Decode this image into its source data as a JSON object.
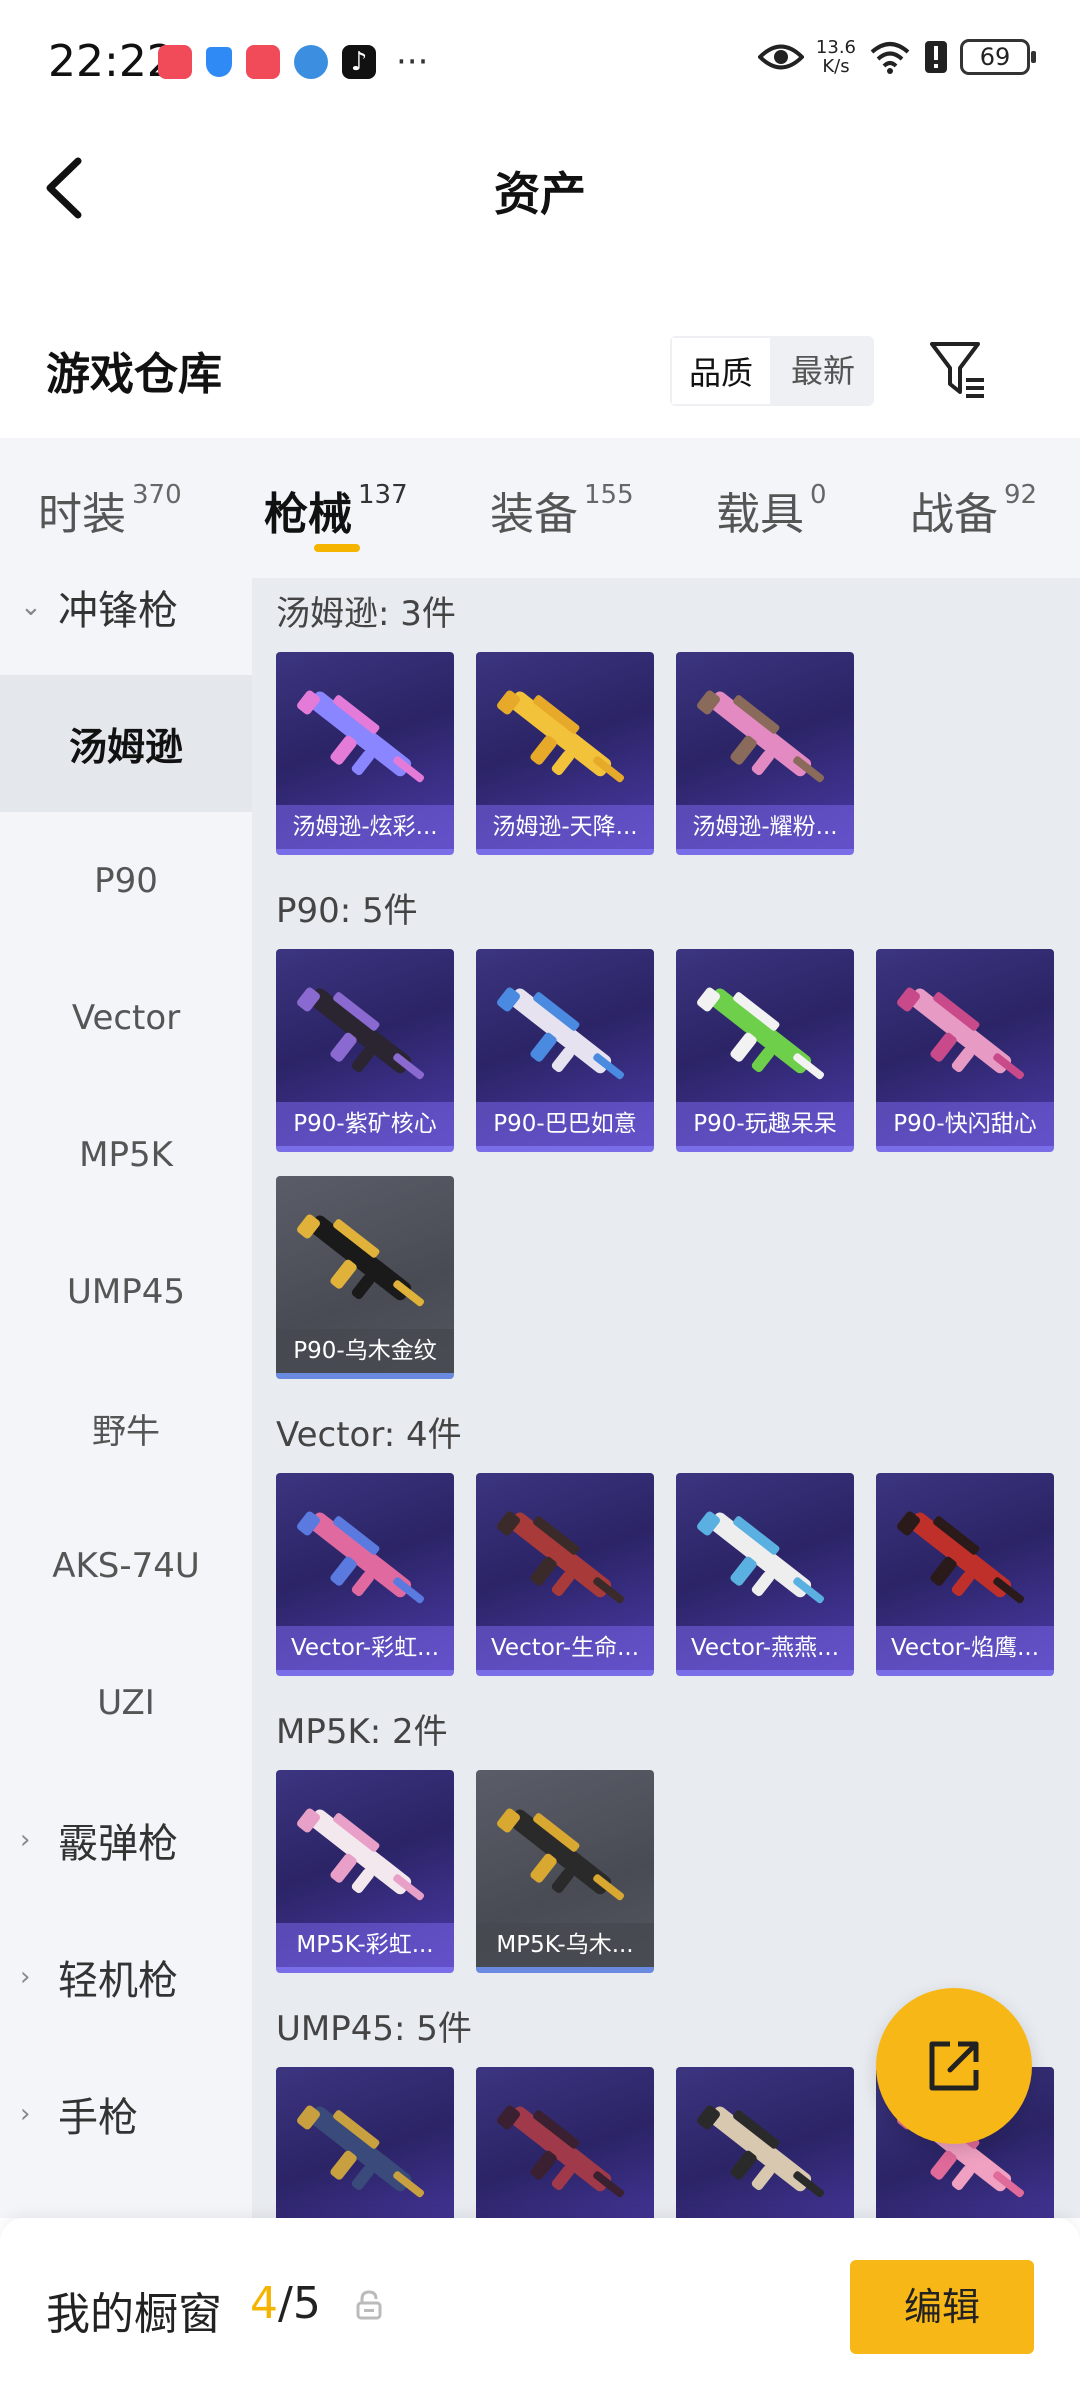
{
  "status": {
    "time": "22:22",
    "net_speed_value": "13.6",
    "net_speed_unit": "K/s",
    "battery": "69",
    "more": "···"
  },
  "header": {
    "title": "资产"
  },
  "section": {
    "title": "游戏仓库",
    "sort_options": [
      "品质",
      "最新"
    ],
    "sort_selected": "品质"
  },
  "tabs": [
    {
      "label": "时装",
      "count": "370"
    },
    {
      "label": "枪械",
      "count": "137"
    },
    {
      "label": "装备",
      "count": "155"
    },
    {
      "label": "载具",
      "count": "0"
    },
    {
      "label": "战备",
      "count": "92"
    }
  ],
  "active_tab": "枪械",
  "sidebar": [
    {
      "label": "冲锋枪",
      "type": "group",
      "expanded": true
    },
    {
      "label": "汤姆逊",
      "type": "item",
      "active": true
    },
    {
      "label": "P90",
      "type": "item"
    },
    {
      "label": "Vector",
      "type": "item"
    },
    {
      "label": "MP5K",
      "type": "item"
    },
    {
      "label": "UMP45",
      "type": "item"
    },
    {
      "label": "野牛",
      "type": "item"
    },
    {
      "label": "AKS-74U",
      "type": "item"
    },
    {
      "label": "UZI",
      "type": "item"
    },
    {
      "label": "霰弹枪",
      "type": "group",
      "expanded": false
    },
    {
      "label": "轻机枪",
      "type": "group",
      "expanded": false
    },
    {
      "label": "手枪",
      "type": "group",
      "expanded": false
    }
  ],
  "groups": [
    {
      "title": "汤姆逊: 3件",
      "items": [
        {
          "label": "汤姆逊-炫彩...",
          "tone": "purple",
          "colors": [
            "#8a86ff",
            "#e57bd8"
          ]
        },
        {
          "label": "汤姆逊-天降...",
          "tone": "purple",
          "colors": [
            "#f2c23a",
            "#e6a92a"
          ]
        },
        {
          "label": "汤姆逊-耀粉...",
          "tone": "purple",
          "colors": [
            "#e38ac2",
            "#8a6a5a"
          ]
        }
      ]
    },
    {
      "title": "P90: 5件",
      "items": [
        {
          "label": "P90-紫矿核心",
          "tone": "purple",
          "colors": [
            "#2a2530",
            "#8a6ad0"
          ]
        },
        {
          "label": "P90-巴巴如意",
          "tone": "purple",
          "colors": [
            "#e6e2f0",
            "#4a8ae0"
          ]
        },
        {
          "label": "P90-玩趣呆呆",
          "tone": "purple",
          "colors": [
            "#6ed04a",
            "#f2f2f2"
          ]
        },
        {
          "label": "P90-快闪甜心",
          "tone": "purple",
          "colors": [
            "#e79ac4",
            "#c84a8a"
          ]
        },
        {
          "label": "P90-乌木金纹",
          "tone": "grey",
          "colors": [
            "#1a1a1a",
            "#e0b23a"
          ]
        }
      ]
    },
    {
      "title": "Vector: 4件",
      "items": [
        {
          "label": "Vector-彩虹...",
          "tone": "purple",
          "colors": [
            "#e06aa0",
            "#5a7ae0"
          ]
        },
        {
          "label": "Vector-生命...",
          "tone": "purple",
          "colors": [
            "#a83a3a",
            "#3a2a2a"
          ]
        },
        {
          "label": "Vector-燕燕...",
          "tone": "purple",
          "colors": [
            "#eeeeee",
            "#5ab0e0"
          ]
        },
        {
          "label": "Vector-焰鹰...",
          "tone": "purple",
          "colors": [
            "#c0302a",
            "#2a1a1a"
          ]
        }
      ]
    },
    {
      "title": "MP5K: 2件",
      "items": [
        {
          "label": "MP5K-彩虹...",
          "tone": "purple",
          "colors": [
            "#f2e8ee",
            "#e8a0c8"
          ]
        },
        {
          "label": "MP5K-乌木...",
          "tone": "grey",
          "colors": [
            "#2a2a2a",
            "#d8a830"
          ]
        }
      ]
    },
    {
      "title": "UMP45: 5件",
      "items": [
        {
          "label": "",
          "tone": "purple",
          "colors": [
            "#3a4a7a",
            "#c8a040"
          ]
        },
        {
          "label": "",
          "tone": "purple",
          "colors": [
            "#a03a4a",
            "#3a2030"
          ]
        },
        {
          "label": "",
          "tone": "purple",
          "colors": [
            "#d8c8b0",
            "#2a2a2a"
          ]
        },
        {
          "label": "",
          "tone": "purple",
          "colors": [
            "#f0a0c0",
            "#e06a9a"
          ]
        }
      ]
    }
  ],
  "showcase": {
    "label": "我的橱窗",
    "current": "4",
    "separator": "/5",
    "edit_label": "编辑"
  },
  "colors": {
    "accent": "#f7b817",
    "card_purple": "#2b2466",
    "card_grey": "#4b4d56"
  }
}
